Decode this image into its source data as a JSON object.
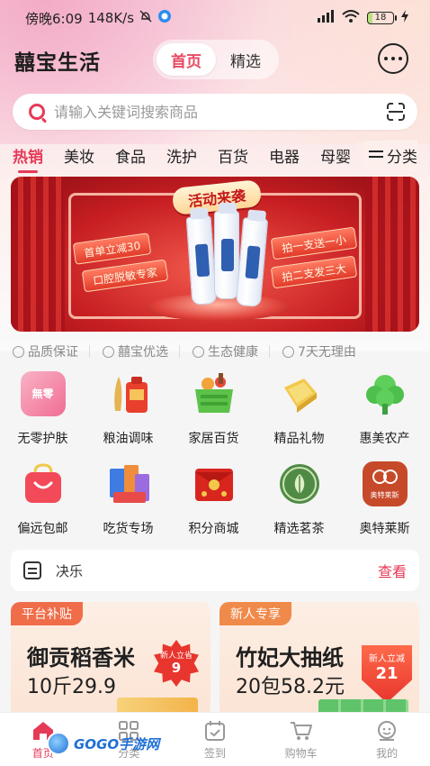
{
  "status_bar": {
    "time": "傍晚6:09",
    "speed": "148K/s",
    "battery": "18"
  },
  "header": {
    "brand": "囍宝生活",
    "tabs": [
      {
        "label": "首页",
        "active": true
      },
      {
        "label": "精选",
        "active": false
      }
    ]
  },
  "search": {
    "placeholder": "请输入关键词搜索商品"
  },
  "categories": {
    "items": [
      "热销",
      "美妆",
      "食品",
      "洗护",
      "百货",
      "电器",
      "母婴"
    ],
    "active_index": 0,
    "more_label": "分类"
  },
  "banner": {
    "title": "活动来袭",
    "tags": [
      "首单立减30",
      "口腔脱敏专家",
      "拍一支送一小",
      "拍二支发三大"
    ]
  },
  "guarantees": [
    "品质保证",
    "囍宝优选",
    "生态健康",
    "7天无理由"
  ],
  "grid": [
    {
      "label": "无零护肤",
      "icon": "skincare-icon",
      "pic_text": "無零"
    },
    {
      "label": "粮油调味",
      "icon": "grain-oil-icon"
    },
    {
      "label": "家居百货",
      "icon": "basket-icon"
    },
    {
      "label": "精品礼物",
      "icon": "gift-icon"
    },
    {
      "label": "惠美农产",
      "icon": "tree-icon"
    },
    {
      "label": "偏远包邮",
      "icon": "shopping-bag-icon"
    },
    {
      "label": "吃货专场",
      "icon": "snacks-icon"
    },
    {
      "label": "积分商城",
      "icon": "red-envelope-icon"
    },
    {
      "label": "精选茗茶",
      "icon": "tea-icon"
    },
    {
      "label": "奥特莱斯",
      "icon": "outlets-icon",
      "pic_text": "奥特莱斯"
    }
  ],
  "notice": {
    "text": "决乐",
    "link": "查看"
  },
  "cards": [
    {
      "badge": "平台补贴",
      "title": "御贡稻香米",
      "subtitle": "10斤29.9",
      "tag_small": "新人立省",
      "tag_big": "9",
      "badge_color": "#f06d4a"
    },
    {
      "badge": "新人专享",
      "title": "竹妃大抽纸",
      "subtitle": "20包58.2元",
      "tag_small": "新人立减",
      "tag_big": "21",
      "badge_color": "#f08a4a"
    }
  ],
  "tabbar": [
    {
      "label": "首页",
      "icon": "home-icon",
      "active": true
    },
    {
      "label": "分类",
      "icon": "category-icon",
      "active": false
    },
    {
      "label": "签到",
      "icon": "calendar-check-icon",
      "active": false
    },
    {
      "label": "购物车",
      "icon": "cart-icon",
      "active": false
    },
    {
      "label": "我的",
      "icon": "profile-icon",
      "active": false
    }
  ],
  "watermark": "GOGO手游网",
  "colors": {
    "accent": "#e53a57",
    "banner_red": "#c81f23"
  }
}
